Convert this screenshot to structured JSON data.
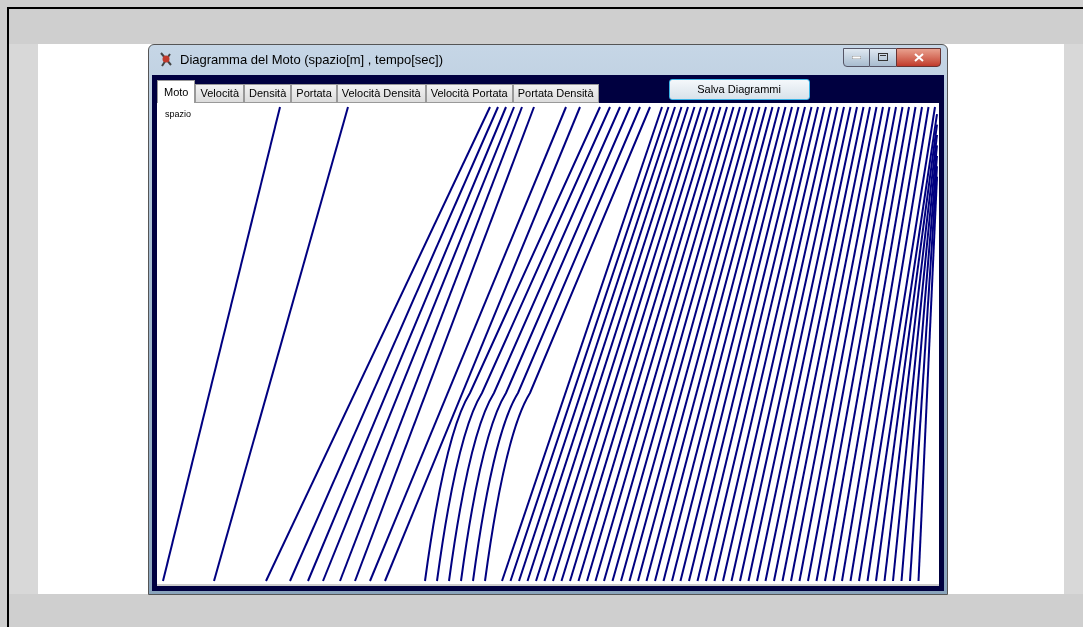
{
  "window": {
    "title": "Diagramma del Moto (spazio[m] , tempo[sec])"
  },
  "tabs": [
    {
      "label": "Moto",
      "selected": true
    },
    {
      "label": "Velocità",
      "selected": false
    },
    {
      "label": "Densità",
      "selected": false
    },
    {
      "label": "Portata",
      "selected": false
    },
    {
      "label": "Velocità Densità",
      "selected": false
    },
    {
      "label": "Velocità Portata",
      "selected": false
    },
    {
      "label": "Portata Densità",
      "selected": false
    }
  ],
  "save_button": "Salva Diagrammi",
  "plot": {
    "y_axis_label": "spazio"
  }
}
